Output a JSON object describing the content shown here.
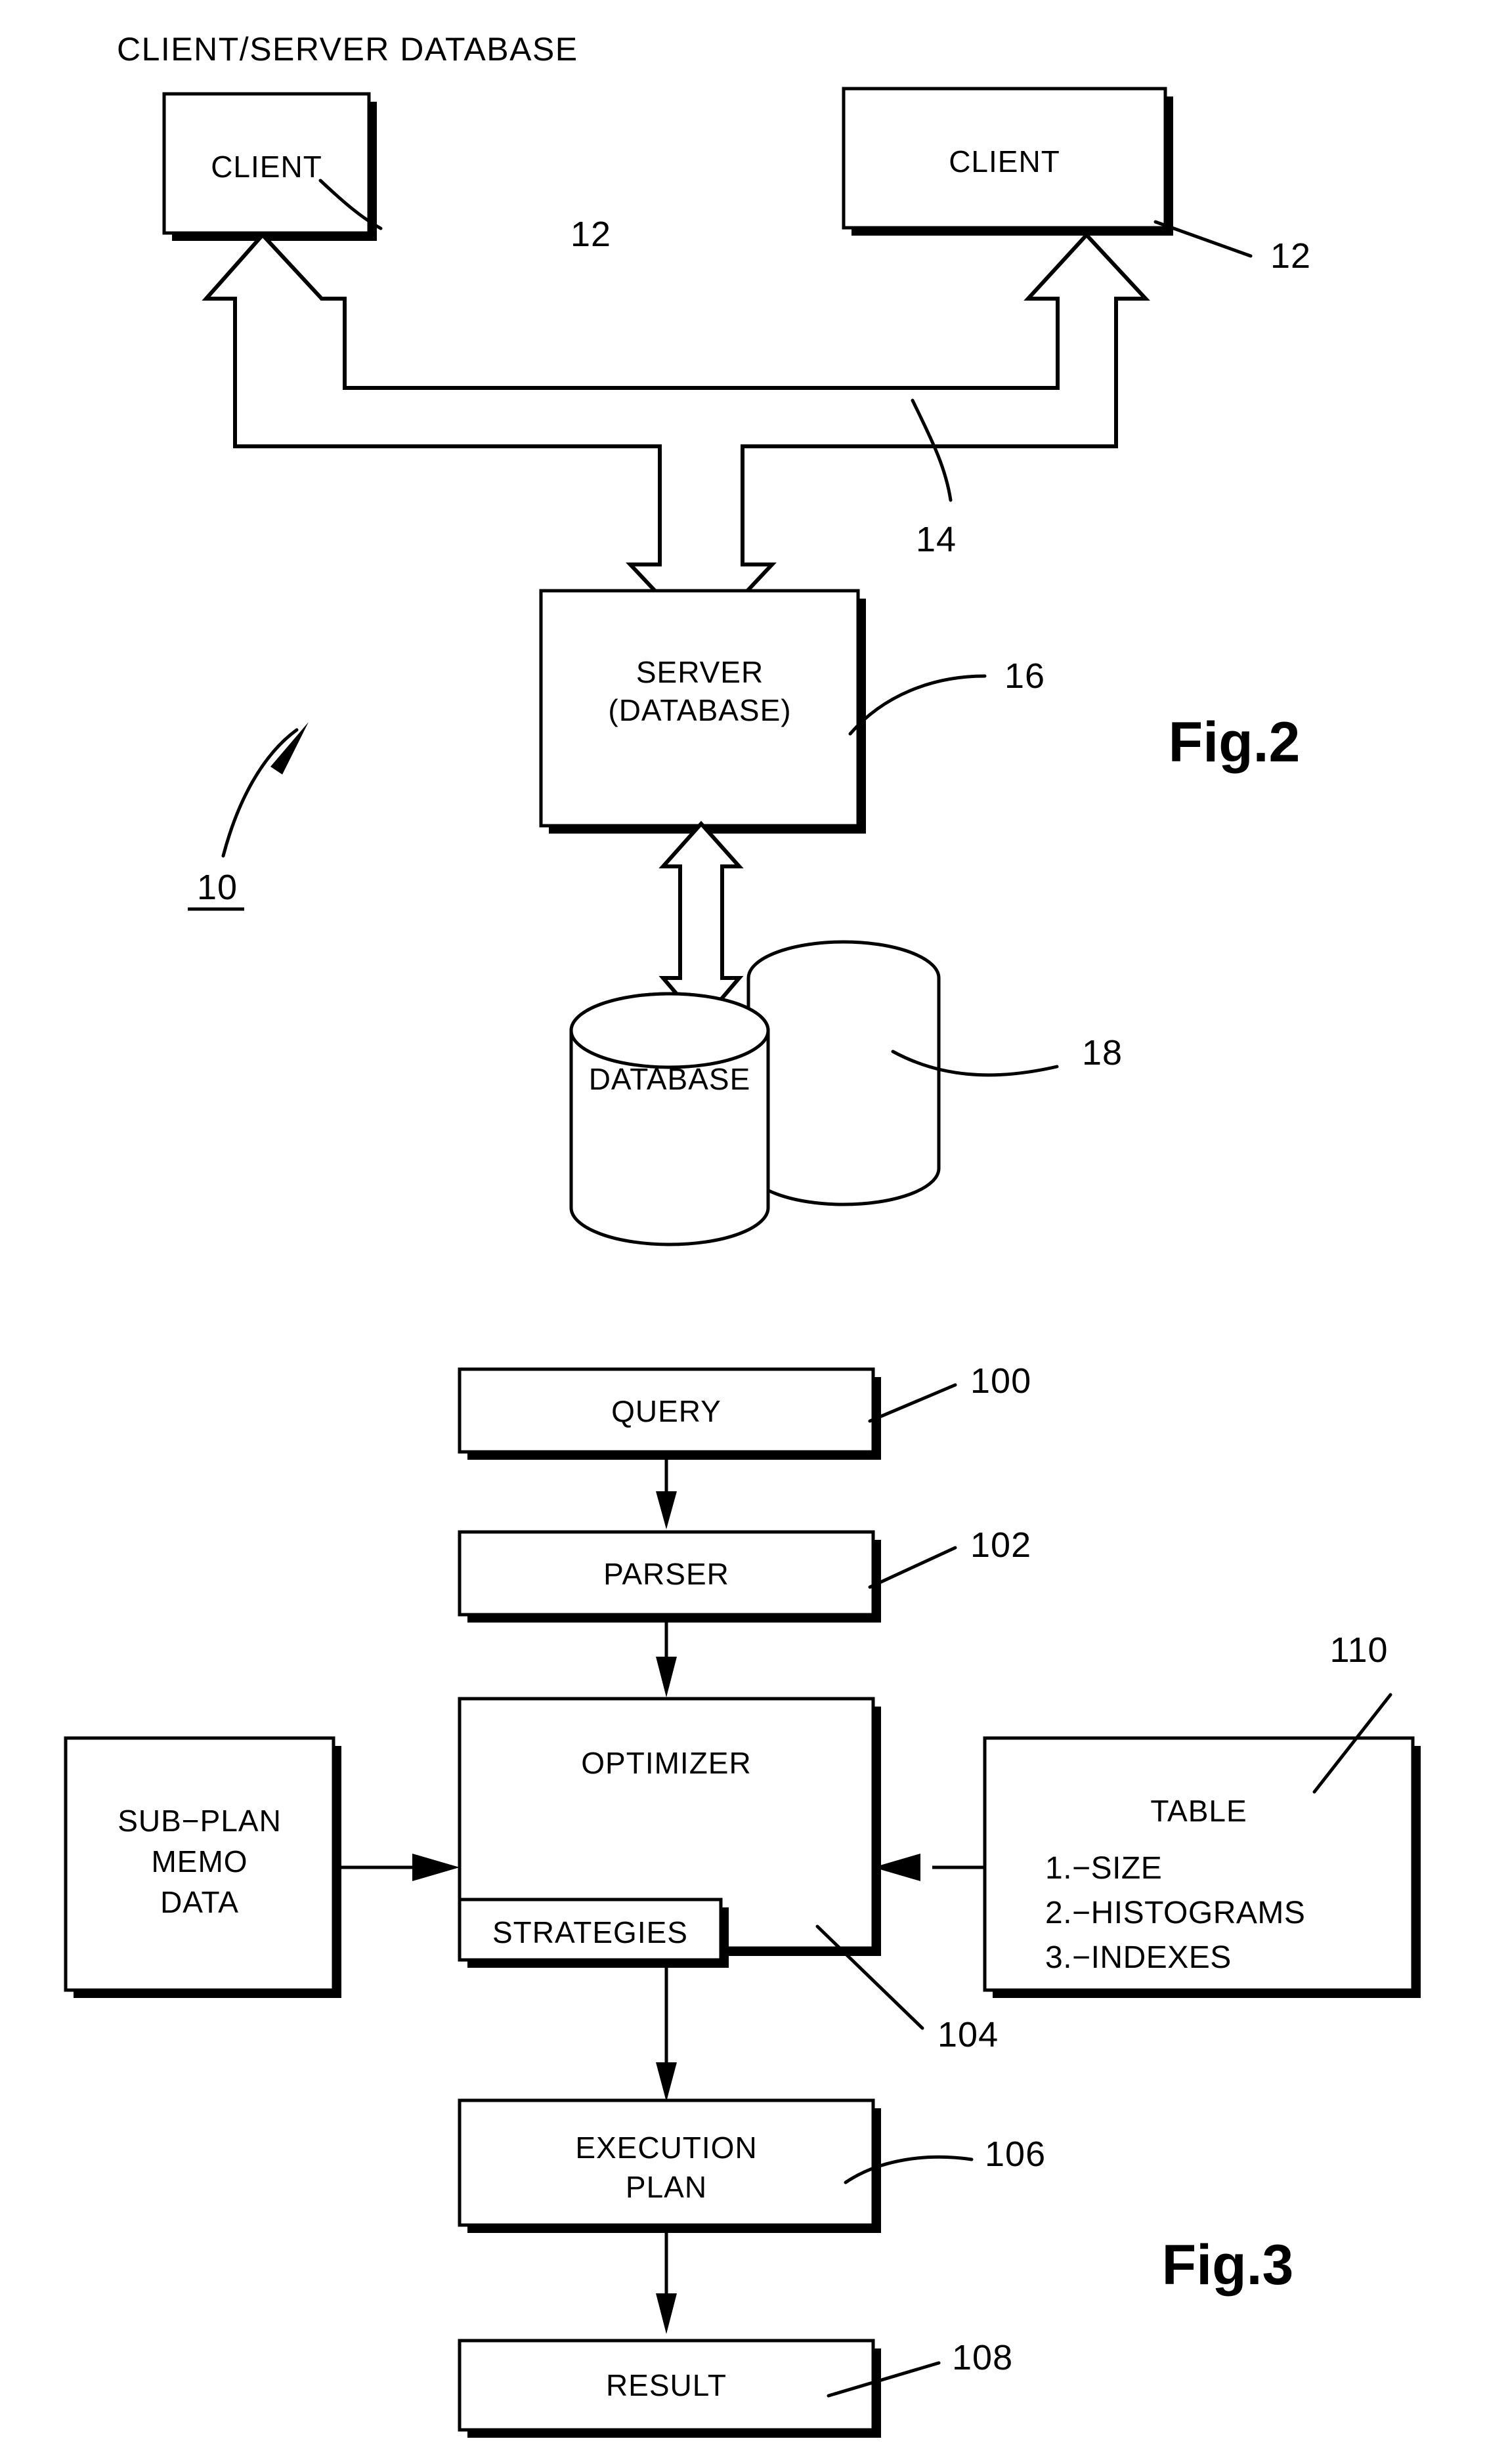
{
  "figure2": {
    "title": "CLIENT/SERVER  DATABASE",
    "fig_label": "Fig.2",
    "system_ref": "10",
    "nodes": {
      "client_left": {
        "label": "CLIENT",
        "ref": "12"
      },
      "client_right": {
        "label": "CLIENT",
        "ref": "12"
      },
      "network": {
        "ref": "14"
      },
      "server": {
        "label_line1": "SERVER",
        "label_line2": "(DATABASE)",
        "ref": "16"
      },
      "database": {
        "label": "DATABASE",
        "ref": "18"
      }
    }
  },
  "figure3": {
    "fig_label": "Fig.3",
    "nodes": {
      "query": {
        "label": "QUERY",
        "ref": "100"
      },
      "parser": {
        "label": "PARSER",
        "ref": "102"
      },
      "optimizer": {
        "label": "OPTIMIZER",
        "ref": "104"
      },
      "strategies": {
        "label": "STRATEGIES"
      },
      "subplan": {
        "label_line1": "SUB−PLAN",
        "label_line2": "MEMO",
        "label_line3": "DATA"
      },
      "table": {
        "label": "TABLE",
        "ref": "110",
        "items": [
          "1.−SIZE",
          "2.−HISTOGRAMS",
          "3.−INDEXES"
        ]
      },
      "execution_plan": {
        "label_line1": "EXECUTION",
        "label_line2": "PLAN",
        "ref": "106"
      },
      "result": {
        "label": "RESULT",
        "ref": "108"
      }
    }
  },
  "colors": {
    "ink": "#000000",
    "paper": "#ffffff"
  }
}
